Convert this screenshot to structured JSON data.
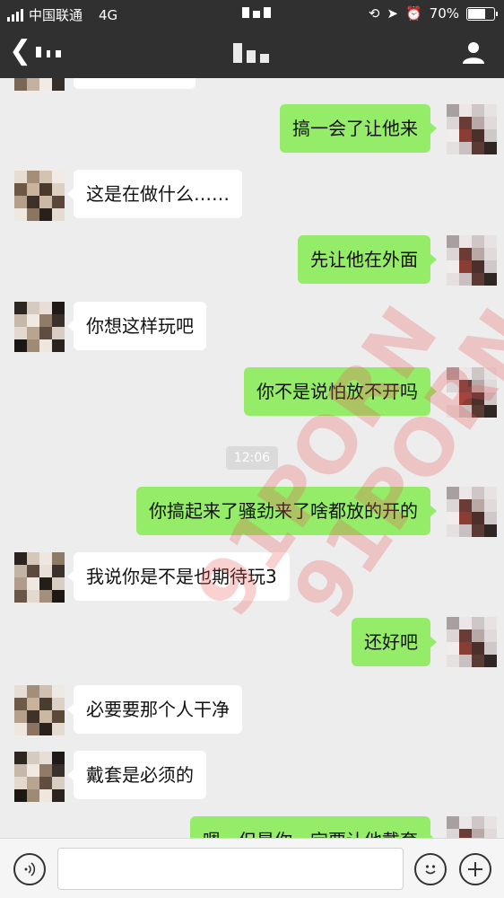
{
  "status": {
    "carrier": "中国联通",
    "network": "4G",
    "battery": "70%",
    "battery_level": 0.7
  },
  "timestamp": "12:06",
  "messages": [
    {
      "side": "out",
      "text": "搞一会了让他来"
    },
    {
      "side": "in",
      "text": "这是在做什么……"
    },
    {
      "side": "out",
      "text": "先让他在外面"
    },
    {
      "side": "in",
      "text": "你想这样玩吧"
    },
    {
      "side": "out",
      "text": "你不是说怕放不开吗"
    },
    {
      "side": "out",
      "text": "你搞起来了骚劲来了啥都放的开的"
    },
    {
      "side": "in",
      "text": "我说你是不是也期待玩3"
    },
    {
      "side": "out",
      "text": "还好吧"
    },
    {
      "side": "in",
      "text": "必要要那个人干净"
    },
    {
      "side": "in",
      "text": "戴套是必须的"
    },
    {
      "side": "out",
      "text": "嗯，但是你一定要让他戴套"
    }
  ],
  "watermark": "91PORN",
  "icons": {
    "back": "chevron-left-icon",
    "profile": "user-icon",
    "voice": "voice-icon",
    "emoji": "emoji-icon",
    "more": "plus-icon"
  }
}
